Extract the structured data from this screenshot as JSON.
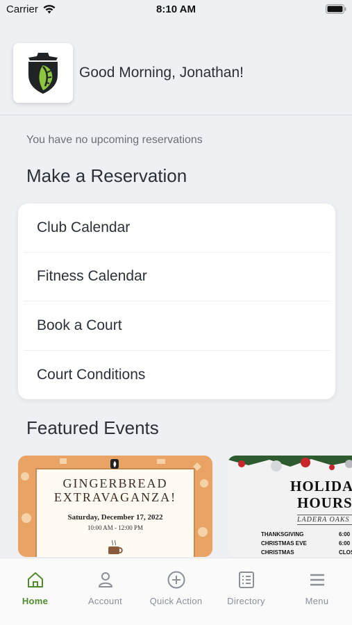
{
  "status_bar": {
    "carrier": "Carrier",
    "time": "8:10 AM"
  },
  "header": {
    "greeting": "Good Morning, Jonathan!"
  },
  "reservations": {
    "empty_text": "You have no upcoming reservations",
    "section_title": "Make a Reservation",
    "items": [
      {
        "label": "Club Calendar"
      },
      {
        "label": "Fitness Calendar"
      },
      {
        "label": "Book a Court"
      },
      {
        "label": "Court Conditions"
      }
    ]
  },
  "featured": {
    "section_title": "Featured Events",
    "events": [
      {
        "title_line1": "GINGERBREAD",
        "title_line2": "EXTRAVAGANZA!",
        "date": "Saturday, December 17, 2022",
        "time": "10:00 AM - 12:00 PM"
      },
      {
        "title_line1": "HOLIDA",
        "title_line2": "HOURS",
        "subtitle": "LADERA OAKS",
        "rows": [
          {
            "label": "THANKSGIVING",
            "value": "6:00"
          },
          {
            "label": "CHRISTMAS EVE",
            "value": "6:00"
          },
          {
            "label": "CHRISTMAS",
            "value": "CLOS"
          }
        ]
      }
    ]
  },
  "tab_bar": {
    "tabs": [
      {
        "label": "Home",
        "icon": "home-icon",
        "active": true
      },
      {
        "label": "Account",
        "icon": "person-icon",
        "active": false
      },
      {
        "label": "Quick Action",
        "icon": "plus-circle-icon",
        "active": false
      },
      {
        "label": "Directory",
        "icon": "list-icon",
        "active": false
      },
      {
        "label": "Menu",
        "icon": "hamburger-icon",
        "active": false
      }
    ]
  },
  "colors": {
    "accent": "#4f8a2c",
    "tab_inactive": "#8a8f98",
    "background": "#eef0f3"
  }
}
